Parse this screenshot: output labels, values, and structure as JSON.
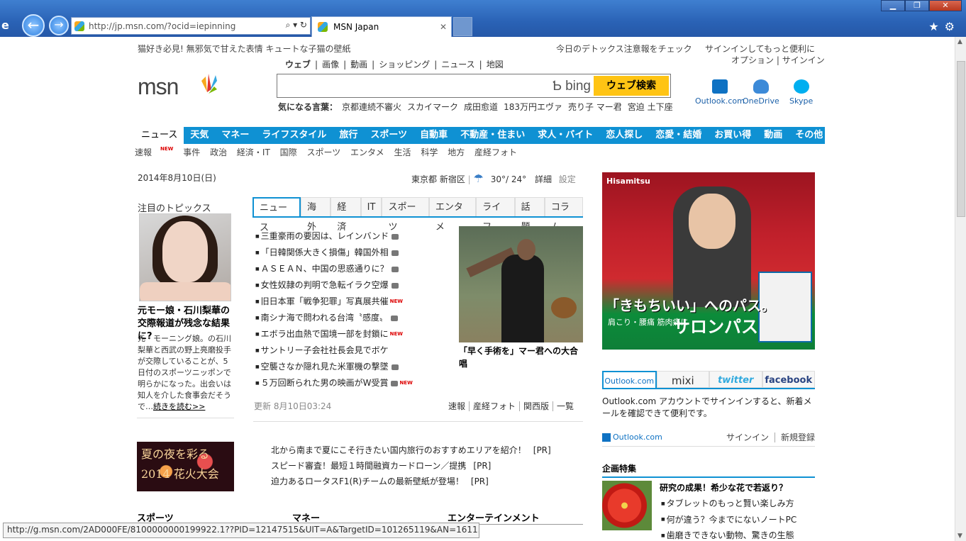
{
  "browser": {
    "address_url": "http://jp.msn.com/?ocid=iepinning",
    "tab_title": "MSN Japan",
    "status_url": "http://g.msn.com/2AD000FE/8100000000199922.1??PID=12147515&UIT=A&TargetID=101265119&AN=1611..."
  },
  "header": {
    "promo_left": "猫好き必見! 無邪気で甘えた表情 キュートな子猫の壁紙",
    "promo_mid": "今日のデトックス注意報をチェック",
    "signin_promo": "サインインしてもっと便利に",
    "options": "オプション",
    "signin": "サインイン",
    "search_tabs": [
      "ウェブ",
      "画像",
      "動画",
      "ショッピング",
      "ニュース",
      "地図"
    ],
    "logo_text": "msn",
    "bing_text": "bing",
    "search_button": "ウェブ検索",
    "hot_label": "気になる言葉：",
    "hot_words": [
      "京都連続不審火",
      "スカイマーク",
      "成田愈道",
      "183万円エヴァ",
      "売り子 マー君",
      "宮迫 土下座"
    ],
    "services": [
      {
        "label": "Outlook.com",
        "icon": "outlook-icon",
        "color": "#0f72c3"
      },
      {
        "label": "OneDrive",
        "icon": "onedrive-icon",
        "color": "#3c8ad8"
      },
      {
        "label": "Skype",
        "icon": "skype-icon",
        "color": "#00aff0"
      }
    ]
  },
  "categories": [
    "ニュース",
    "天気",
    "マネー",
    "ライフスタイル",
    "旅行",
    "スポーツ",
    "自動車",
    "不動産・住まい",
    "求人・バイト",
    "恋人探し",
    "恋愛・結婚",
    "お買い得",
    "動画",
    "その他"
  ],
  "subcategories": [
    "速報",
    "事件",
    "政治",
    "経済・IT",
    "国際",
    "スポーツ",
    "エンタメ",
    "生活",
    "科学",
    "地方",
    "産経フォト"
  ],
  "new_badge": "NEW",
  "date_line": {
    "date": "2014年8月10日(日)",
    "location": "東京都 新宿区",
    "temps": "30°/ 24°",
    "detail": "詳細",
    "settings": "設定"
  },
  "feature": {
    "label": "注目のトピックス",
    "title": "元モー娘・石川梨華の交際報道が残念な結果に?",
    "body": "元・モーニング娘。の石川梨華と西武の野上亮磨投手が交際していることが、5日付のスポーツニッポンで明らかになった。出会いは知人を介した食事会だそうで…",
    "more": "続きを読む>>"
  },
  "news_tabs": [
    "ニュース",
    "海外",
    "経済",
    "IT",
    "スポーツ",
    "エンタメ",
    "ライフ",
    "話題",
    "コラム"
  ],
  "news_items": [
    {
      "text": "三重豪雨の要因は、レインバンド",
      "cam": true,
      "isnew": false
    },
    {
      "text": "「日韓関係大きく損傷」韓国外相",
      "cam": true,
      "isnew": false
    },
    {
      "text": "ＡＳＥＡＮ、中国の思惑通りに？",
      "cam": true,
      "isnew": false
    },
    {
      "text": "女性奴隷の判明で急転イラク空爆",
      "cam": true,
      "isnew": false
    },
    {
      "text": "旧日本軍「戦争犯罪」写真展共催",
      "cam": false,
      "isnew": true
    },
    {
      "text": "南シナ海で問われる台湾〝感度〟",
      "cam": true,
      "isnew": false
    },
    {
      "text": "エボラ出血熱で国境一部を封鎖に",
      "cam": false,
      "isnew": true
    },
    {
      "text": "サントリー子会社社長会見でボケ",
      "cam": false,
      "isnew": false
    },
    {
      "text": "空襲さなか隠れ見た米軍機の撃墜",
      "cam": true,
      "isnew": false
    },
    {
      "text": "５万回断られた男の映画がW受賞",
      "cam": true,
      "isnew": true
    }
  ],
  "photo_caption": "「早く手術を」マー君への大合唱",
  "updated": "更新 8月10日03:24",
  "quick_links": [
    "速報",
    "産経フォト",
    "関西版",
    "一覧"
  ],
  "firework_text": "夏の夜を彩る 2014 花火大会",
  "pr_items": [
    {
      "text": "北から南まで夏にこそ行きたい国内旅行のおすすめエリアを紹介！",
      "tag": "[PR]"
    },
    {
      "text": "スピード審査！最短１時間融資カードローン／提携",
      "tag": "[PR]"
    },
    {
      "text": "迫力あるロータスF1(R)チームの最新壁紙が登場！",
      "tag": "[PR]"
    }
  ],
  "section_headers": [
    "スポーツ",
    "マネー",
    "エンターテインメント"
  ],
  "ad": {
    "brand": "Hisamitsu",
    "copy": "「きもちいい」へのパス。",
    "copy2": "肩こり・腰痛 筋肉痛に",
    "product": "サロンパス"
  },
  "social_tabs": [
    "Outlook.com",
    "mixi",
    "twitter",
    "facebook"
  ],
  "social_text": "Outlook.com アカウントでサインインすると、新着メールを確認できて便利です。",
  "outlook_logo": "Outlook.com",
  "outlook_signin": "サインイン",
  "outlook_register": "新規登録",
  "kikaku": {
    "header": "企画特集",
    "title": "研究の成果！希少な花で若返り？",
    "items": [
      "タブレットのもっと賢い楽しみ方",
      "何が違う？今までにないノートPC",
      "歯磨きできない動物、驚きの生態"
    ]
  }
}
